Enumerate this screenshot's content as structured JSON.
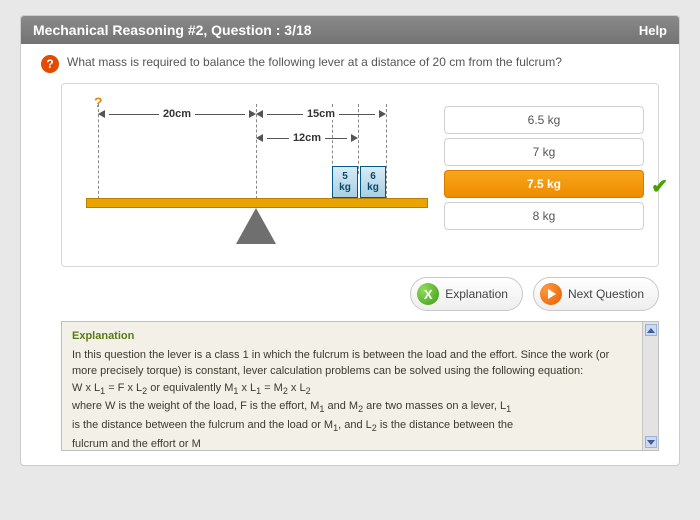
{
  "titlebar": {
    "title": "Mechanical Reasoning #2, Question : 3/18",
    "help": "Help"
  },
  "question": {
    "icon": "?",
    "text": "What mass is required to balance the following lever at a distance of 20 cm from the fulcrum?"
  },
  "diagram": {
    "unknown": "?",
    "dim1": "20cm",
    "dim2": "15cm",
    "dim3": "12cm",
    "block1_val": "5",
    "block1_unit": "kg",
    "block2_val": "6",
    "block2_unit": "kg"
  },
  "answers": {
    "items": [
      {
        "label": "6.5 kg",
        "selected": false
      },
      {
        "label": "7 kg",
        "selected": false
      },
      {
        "label": "7.5 kg",
        "selected": true
      },
      {
        "label": "8 kg",
        "selected": false
      }
    ],
    "check": "✔"
  },
  "actions": {
    "explain": "Explanation",
    "explain_icon": "X",
    "next": "Next Question"
  },
  "explanation": {
    "heading": "Explanation",
    "line1": "In this question the lever is a class 1 in which the fulcrum is between the load and the effort. Since the work (or more precisely torque) is constant, lever calculation problems can be solved using the following equation:",
    "eq_a": "W x L",
    "eq_b": " = F x L",
    "eq_c": " or equivalently M",
    "eq_d": " x L",
    "eq_e": " = M",
    "eq_f": " x L",
    "line2a": "where W is the weight of the load, F is the effort, M",
    "line2b": " and M",
    "line2c": " are two masses on a lever, L",
    "line3a": "is the distance between the fulcrum and the load or M",
    "line3b": ", and L",
    "line3c": " is the distance between the",
    "line4": "fulcrum and the effort or M"
  }
}
